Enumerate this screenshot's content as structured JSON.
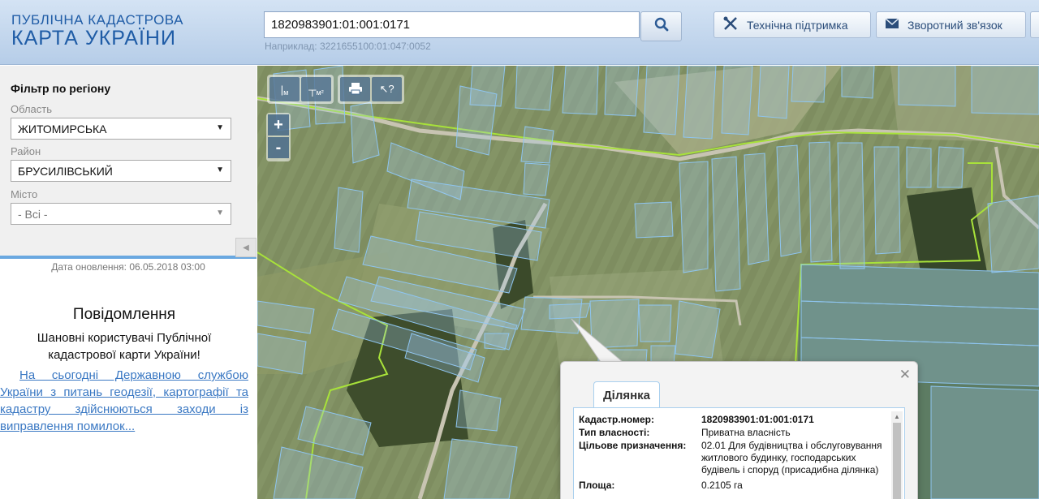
{
  "header": {
    "logo_line1": "ПУБЛІЧНА КАДАСТРОВА",
    "logo_line2": "КАРТА УКРАЇНИ",
    "search_value": "1820983901:01:001:0171",
    "search_hint": "Наприклад: 3221655100:01:047:0052",
    "support_label": "Технічна підтримка",
    "feedback_label": "Зворотний зв'язок",
    "icons": [
      "search-icon",
      "tools-icon",
      "envelope-icon"
    ]
  },
  "filter": {
    "title": "Фільтр по регіону",
    "oblast_label": "Область",
    "oblast_value": "ЖИТОМИРСЬКА",
    "raion_label": "Район",
    "raion_value": "БРУСИЛІВСЬКИЙ",
    "misto_label": "Місто",
    "misto_value": "- Всі -"
  },
  "sidebar": {
    "update_date": "Дата оновлення: 06.05.2018 03:00",
    "message_title": "Повідомлення",
    "message_greeting": "Шановні користувачі Публічної кадастрової карти України!",
    "message_link": "На сьогодні Державною службою України з питань геодезії, картографії та кадастру здійснюються заходи із виправлення помилок..."
  },
  "map": {
    "tool_ruler_label": "м",
    "tool_area_label": "м²",
    "zoom_in": "+",
    "zoom_out": "-",
    "parcel_color": "#8ec5f0",
    "boundary_color": "#a8e23a"
  },
  "popup": {
    "tab_label": "Ділянка",
    "rows": [
      {
        "key": "Кадастр.номер:",
        "value": "1820983901:01:001:0171"
      },
      {
        "key": "Тип власності:",
        "value": "Приватна власність"
      },
      {
        "key": "Цільове призначення:",
        "value": "02.01 Для будівництва і обслуговування житлового будинку, господарських будівель і споруд (присадибна ділянка)"
      },
      {
        "key": "Площа:",
        "value": "0.2105 га"
      }
    ]
  }
}
